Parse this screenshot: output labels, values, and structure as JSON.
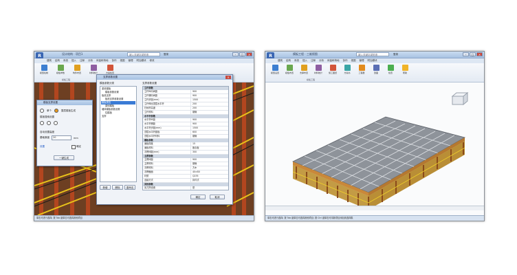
{
  "left_window": {
    "title": "设计结构 · 项目1",
    "search_placeholder": "键入关键字或短语",
    "user": "登录",
    "menu": [
      "建筑",
      "结构",
      "系统",
      "插入",
      "注释",
      "分析",
      "体量和场地",
      "协作",
      "视图",
      "管理",
      "附加模块",
      "修改"
    ],
    "ribbon_tools": [
      "模型绘制",
      "模板参数",
      "构件布置",
      "材料统计",
      "方案检查"
    ],
    "ribbon_panel": "模板工程",
    "status": "单击可进行选择; 按 Tab 键单击可选择其他项目",
    "side_dialog": {
      "title": "模板支撑设置",
      "radio1": "单个",
      "radio2": "整层楼板生成",
      "label1": "楼板搜索设置",
      "label2": "自动设置高度",
      "field_label": "基础厚度",
      "field_value": "20",
      "unit": "mm",
      "link": "设置",
      "checkbox": "确定",
      "button": "一键生成"
    },
    "settings_dialog": {
      "title": "支撑参数设置",
      "tree_header": "模板参数分类",
      "tree": [
        "梁底模板",
        "模板参数设置",
        "板底支撑",
        "板底支撑参数设置",
        "模板属性",
        "梁侧模板",
        "墙体模板参数设置",
        "柱模板",
        "支撑"
      ],
      "grid_header": "支撑参数设置",
      "groups": [
        {
          "name": "立杆参数",
          "rows": [
            [
              "立杆纵向间距",
              "900"
            ],
            [
              "立杆横向间距",
              "900"
            ],
            [
              "立杆步距(mm)",
              "1500"
            ],
            [
              "立杆伸出顶层水平杆",
              "200"
            ],
            [
              "扫地杆高度",
              "200"
            ],
            [
              "立杆材料",
              "钢管"
            ]
          ]
        },
        {
          "name": "水平杆参数",
          "rows": [
            [
              "水平杆纵距",
              "900"
            ],
            [
              "水平杆横距",
              "900"
            ],
            [
              "水平杆步距(mm)",
              "1500"
            ],
            [
              "顶层水平杆距板",
              "600"
            ],
            [
              "顶层水平杆材料",
              "钢管"
            ]
          ]
        },
        {
          "name": "模板参数",
          "rows": [
            [
              "面板厚度",
              "15"
            ],
            [
              "面板材料",
              "胶合板"
            ],
            [
              "次楞间距(mm)",
              "300"
            ]
          ]
        },
        {
          "name": "主楞参数",
          "rows": [
            [
              "主楞间距",
              "900"
            ],
            [
              "主楞材料",
              "钢管"
            ],
            [
              "次楞材料",
              "方木"
            ],
            [
              "次楞截面",
              "40×80"
            ],
            [
              "材质",
              "Q235"
            ],
            [
              "连接方式",
              "扣件式"
            ]
          ]
        },
        {
          "name": "其他参数",
          "rows": [
            [
              "剪刀撑设置",
              "是"
            ],
            [
              "扣件规格",
              "直角扣件"
            ],
            [
              "安全系数",
              "1.2"
            ]
          ]
        }
      ],
      "left_buttons": [
        "新增",
        "删除",
        "重命名"
      ],
      "ok": "确定",
      "cancel": "取消"
    }
  },
  "right_window": {
    "title": "模板工程 · 三维视图",
    "search_placeholder": "键入关键字或短语",
    "user": "登录",
    "menu": [
      "建筑",
      "结构",
      "系统",
      "插入",
      "注释",
      "分析",
      "体量和场地",
      "协作",
      "视图",
      "管理",
      "附加模块"
    ],
    "ribbon_tools": [
      "模型设置",
      "模板布置",
      "支撑布置",
      "材料统计",
      "施工图纸",
      "方案书",
      "工程量",
      "剖面",
      "检查",
      "帮助"
    ],
    "ribbon_panel": "模板工程",
    "status": "单击可进行选择; 按 Tab 键单击可选择其他项目; 按 Ctrl 键单击可将新项目添加到选择集"
  }
}
